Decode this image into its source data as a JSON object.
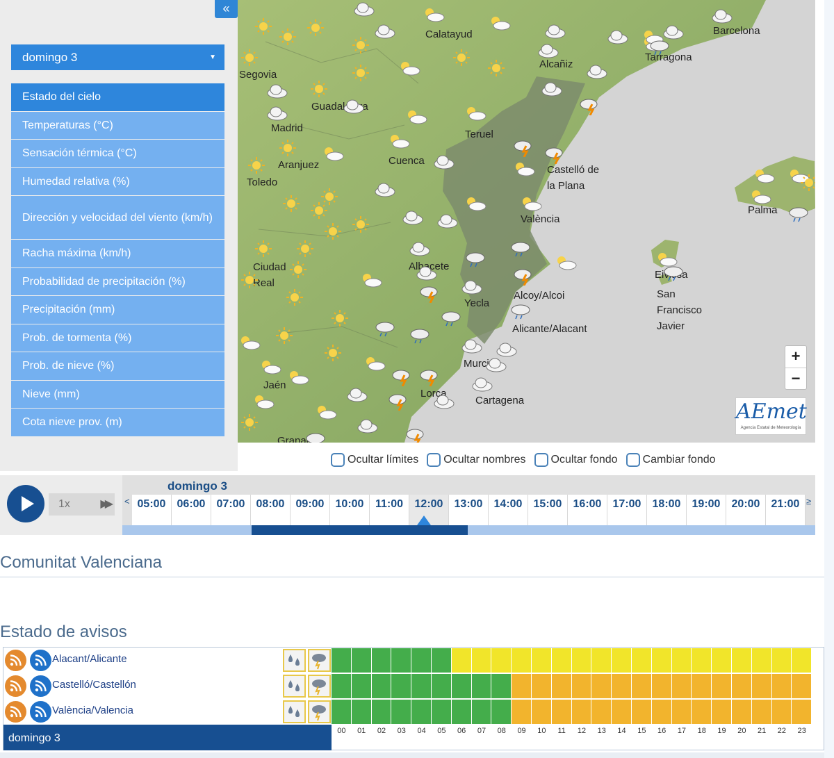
{
  "sidebar": {
    "collapse_label": "«",
    "day_select": "domingo 3",
    "layers": [
      "Estado del cielo",
      "Temperaturas (°C)",
      "Sensación térmica (°C)",
      "Humedad relativa (%)",
      "Dirección y velocidad del viento (km/h)",
      "Racha máxima (km/h)",
      "Probabilidad de precipitación (%)",
      "Precipitación (mm)",
      "Prob. de tormenta (%)",
      "Prob. de nieve (%)",
      "Nieve (mm)",
      "Cota nieve prov. (m)"
    ]
  },
  "map": {
    "cities": {
      "calatayud": "Calatayud",
      "barcelona": "Barcelona",
      "segovia": "Segovia",
      "alcaniz": "Alcañiz",
      "tarragona": "Tarragona",
      "guadalajara": "Guadalajara",
      "madrid": "Madrid",
      "teruel": "Teruel",
      "aranjuez": "Aranjuez",
      "cuenca": "Cuenca",
      "castello": "Castelló de la Plana",
      "toledo": "Toledo",
      "palma": "Palma",
      "valencia": "València",
      "ciudad_real": "Ciudad Real",
      "albacete": "Albacete",
      "eivissa": "Eivissa",
      "yecla": "Yecla",
      "alcoy": "Alcoy/Alcoi",
      "san_francisco": "San Francisco Javier",
      "alicante": "Alicante/Alacant",
      "murcia": "Murcia",
      "jaen": "Jaén",
      "lorca": "Lorca",
      "cartagena": "Cartagena",
      "granada": "Granada"
    },
    "zoom_in": "+",
    "zoom_out": "−",
    "logo_text": "AEmet",
    "logo_sub": "Agencia Estatal de Meteorología"
  },
  "map_options": [
    "Ocultar límites",
    "Ocultar nombres",
    "Ocultar fondo",
    "Cambiar fondo"
  ],
  "timeline": {
    "speed": "1x",
    "day": "domingo 3",
    "hours": [
      "05:00",
      "06:00",
      "07:00",
      "08:00",
      "09:00",
      "10:00",
      "11:00",
      "12:00",
      "13:00",
      "14:00",
      "15:00",
      "16:00",
      "17:00",
      "18:00",
      "19:00",
      "20:00",
      "21:00"
    ],
    "current_hour": "12:00",
    "arrow_left": "<",
    "arrow_right": "≥"
  },
  "region_title": "Comunitat Valenciana",
  "warnings": {
    "title": "Estado de avisos",
    "day": "domingo 3",
    "zones": [
      {
        "name": "Alacant/Alicante",
        "levels": [
          "green",
          "green",
          "green",
          "green",
          "green",
          "green",
          "yellow",
          "yellow",
          "yellow",
          "yellow",
          "yellow",
          "yellow",
          "yellow",
          "yellow",
          "yellow",
          "yellow",
          "yellow",
          "yellow",
          "yellow",
          "yellow",
          "yellow",
          "yellow",
          "yellow",
          "yellow"
        ]
      },
      {
        "name": "Castelló/Castellón",
        "levels": [
          "green",
          "green",
          "green",
          "green",
          "green",
          "green",
          "green",
          "green",
          "green",
          "orange",
          "orange",
          "orange",
          "orange",
          "orange",
          "orange",
          "orange",
          "orange",
          "orange",
          "orange",
          "orange",
          "orange",
          "orange",
          "orange",
          "orange"
        ]
      },
      {
        "name": "València/Valencia",
        "levels": [
          "green",
          "green",
          "green",
          "green",
          "green",
          "green",
          "green",
          "green",
          "green",
          "orange",
          "orange",
          "orange",
          "orange",
          "orange",
          "orange",
          "orange",
          "orange",
          "orange",
          "orange",
          "orange",
          "orange",
          "orange",
          "orange",
          "orange"
        ]
      }
    ],
    "hours": [
      "00",
      "01",
      "02",
      "03",
      "04",
      "05",
      "06",
      "07",
      "08",
      "09",
      "10",
      "11",
      "12",
      "13",
      "14",
      "15",
      "16",
      "17",
      "18",
      "19",
      "20",
      "21",
      "22",
      "23"
    ],
    "level_colors": {
      "green": "#44ad4b",
      "yellow": "#f1e52a",
      "orange": "#f2b42d"
    }
  },
  "weather_icons": [
    "sun-icon",
    "cloud-icon",
    "sun-cloud-icon",
    "rain-icon",
    "storm-icon"
  ]
}
